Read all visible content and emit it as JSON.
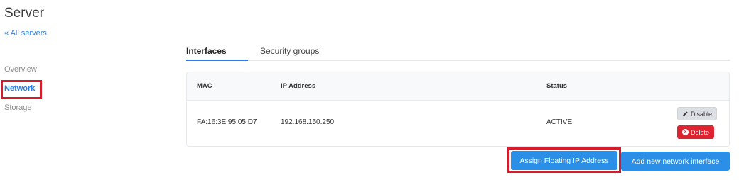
{
  "page": {
    "title": "Server",
    "back_link": "« All servers"
  },
  "sidebar": {
    "items": [
      {
        "label": "Overview",
        "active": false
      },
      {
        "label": "Network",
        "active": true
      },
      {
        "label": "Storage",
        "active": false
      }
    ]
  },
  "tabs": [
    {
      "label": "Interfaces",
      "active": true
    },
    {
      "label": "Security groups",
      "active": false
    }
  ],
  "table": {
    "columns": [
      "MAC",
      "IP Address",
      "Status"
    ],
    "rows": [
      {
        "mac": "FA:16:3E:95:05:D7",
        "ip": "192.168.150.250",
        "status": "ACTIVE",
        "actions": {
          "disable": "Disable",
          "delete": "Delete"
        }
      }
    ]
  },
  "buttons": {
    "assign_floating_ip": "Assign Floating IP Address",
    "add_network_interface": "Add new network interface"
  },
  "icons": {
    "disable": "pencil-icon",
    "delete": "close-circle-icon"
  },
  "colors": {
    "accent": "#2b7de9",
    "primary_button": "#2b8fe8",
    "danger": "#e0242f",
    "highlight_box": "#d81b2a"
  }
}
